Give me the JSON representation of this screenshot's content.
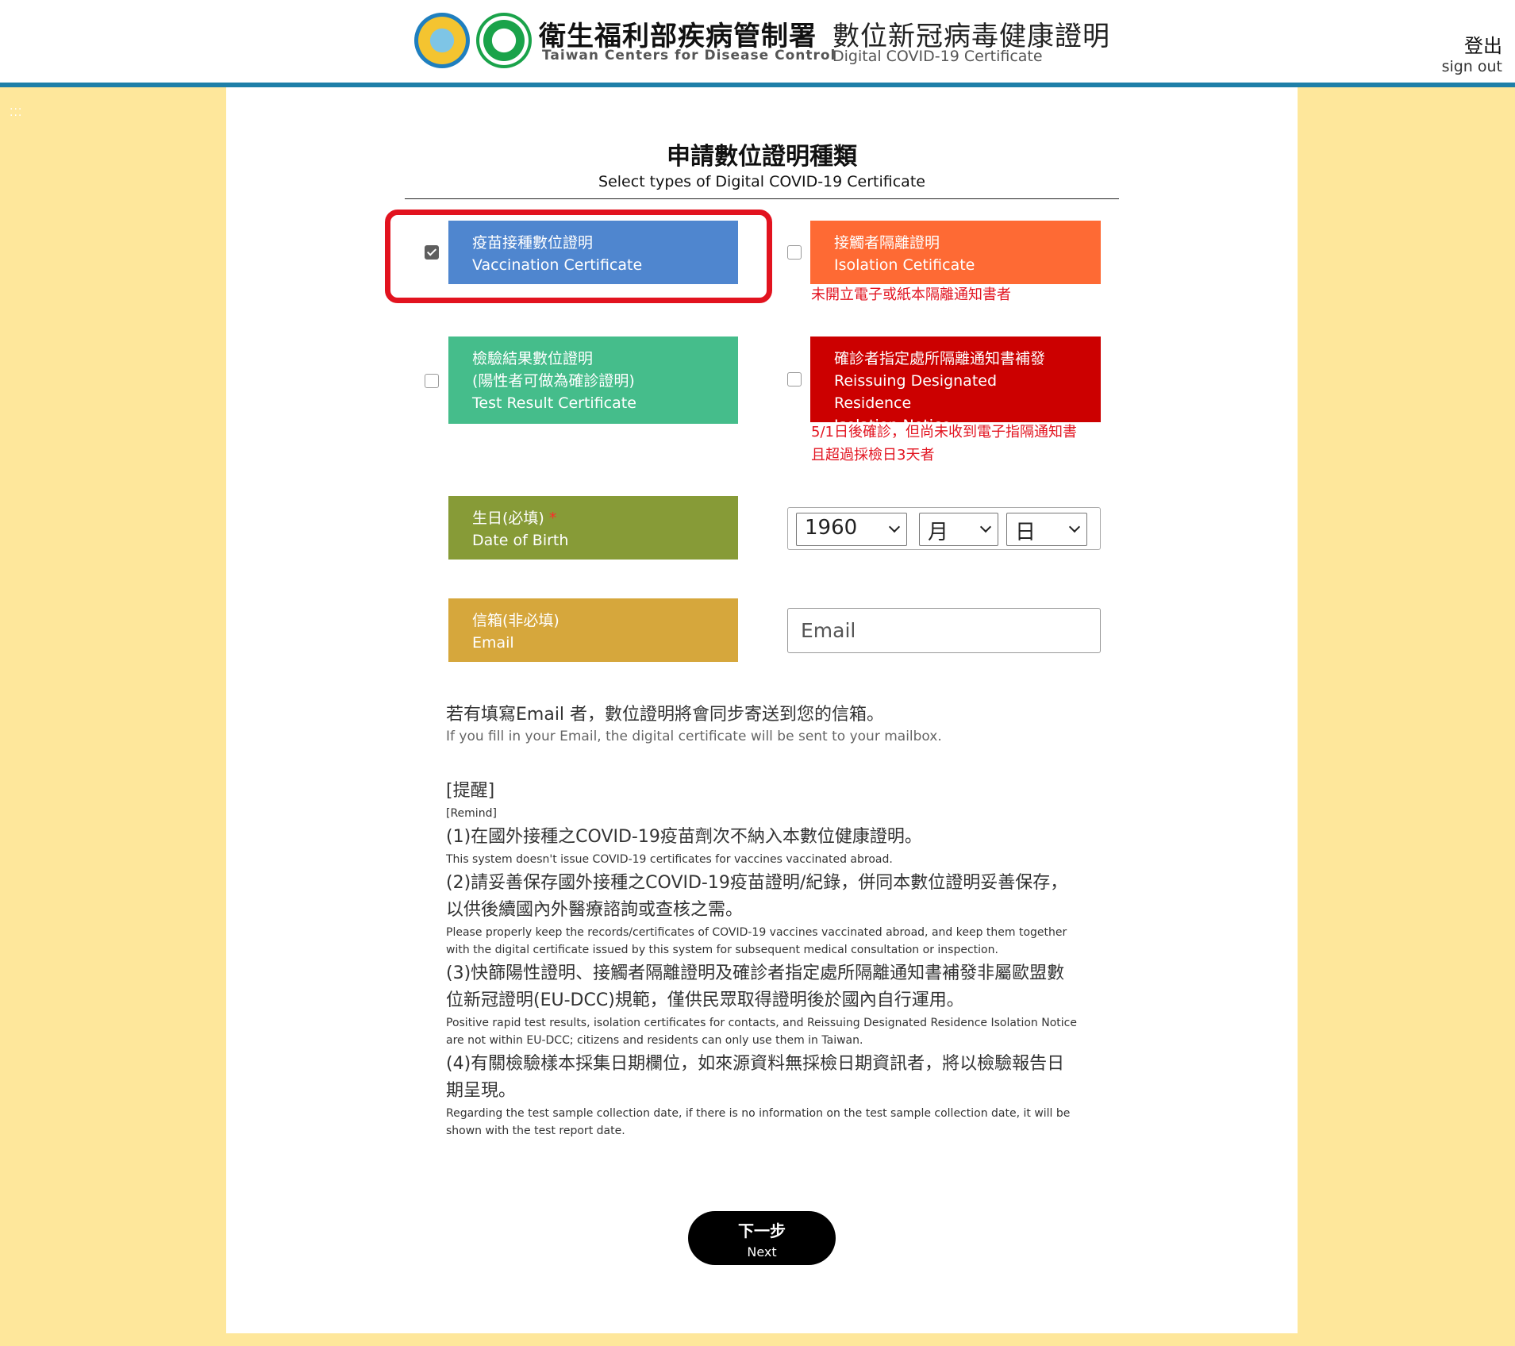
{
  "header": {
    "logo_cn": "衛生福利部疾病管制署",
    "logo_en": "Taiwan Centers for Disease Control",
    "title_cn": "數位新冠病毒健康證明",
    "title_en": "Digital COVID-19 Certificate",
    "signout_cn": "登出",
    "signout_en": "sign out"
  },
  "section": {
    "title_cn": "申請數位證明種類",
    "title_en": "Select types of Digital COVID-19 Certificate"
  },
  "options": {
    "vaccination": {
      "line1": "疫苗接種數位證明",
      "line2": "Vaccination Certificate",
      "checked": true,
      "color": "#4f86cf"
    },
    "isolation": {
      "line1": "接觸者隔離證明",
      "line2": "Isolation Cetificate",
      "note": "未開立電子或紙本隔離通知書者",
      "checked": false,
      "color": "#fe6a34"
    },
    "test_result": {
      "line1": "檢驗結果數位證明",
      "line2": "(陽性者可做為確診證明)",
      "line3": "Test Result Certificate",
      "checked": false,
      "color": "#45bd8b"
    },
    "reissue": {
      "line1": "確診者指定處所隔離通知書補發",
      "line2": "Reissuing Designated Residence",
      "line3": "Isolation Notice",
      "note1": "5/1日後確診，但尚未收到電子指隔通知書",
      "note2": "且超過採檢日3天者",
      "checked": false,
      "color": "#cc0000"
    }
  },
  "dob": {
    "label_cn": "生日(必填)",
    "required_mark": "*",
    "label_en": "Date of Birth",
    "color": "#879b37",
    "year": "1960",
    "month": "月",
    "day": "日"
  },
  "email": {
    "label_cn": "信箱(非必填)",
    "label_en": "Email",
    "color": "#d6a73c",
    "placeholder": "Email"
  },
  "info": {
    "cn": "若有填寫Email 者，數位證明將會同步寄送到您的信箱。",
    "en": "If you fill in your Email, the digital certificate will be sent to your mailbox."
  },
  "remind": {
    "title_cn": "[提醒]",
    "title_en": "[Remind]",
    "items": [
      {
        "cn": "(1)在國外接種之COVID-19疫苗劑次不納入本數位健康證明。",
        "en": "This system doesn't issue COVID-19 certificates for vaccines vaccinated abroad."
      },
      {
        "cn": "(2)請妥善保存國外接種之COVID-19疫苗證明/紀錄，併同本數位證明妥善保存，以供後續國內外醫療諮詢或查核之需。",
        "en": "Please properly keep the records/certificates of COVID-19 vaccines vaccinated abroad, and keep them together with the digital certificate issued by this system for subsequent medical consultation or inspection."
      },
      {
        "cn": "(3)快篩陽性證明、接觸者隔離證明及確診者指定處所隔離通知書補發非屬歐盟數位新冠證明(EU-DCC)規範，僅供民眾取得證明後於國內自行運用。",
        "en": "Positive rapid test results, isolation certificates for contacts, and Reissuing Designated Residence Isolation Notice are not within EU-DCC; citizens and residents can only use them in Taiwan."
      },
      {
        "cn": "(4)有關檢驗樣本採集日期欄位，如來源資料無採檢日期資訊者，將以檢驗報告日期呈現。",
        "en": "Regarding the test sample collection date, if there is no information on the test sample collection date, it will be shown with the test report date."
      }
    ]
  },
  "next": {
    "cn": "下一步",
    "en": "Next"
  }
}
